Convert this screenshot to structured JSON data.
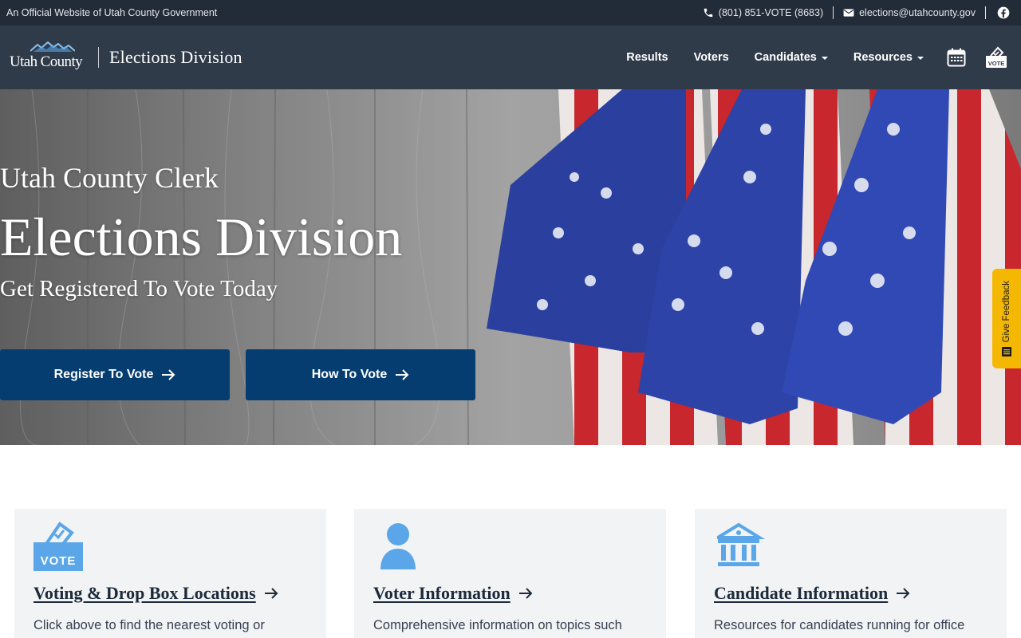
{
  "utility": {
    "official_text": "An Official Website of Utah County Government",
    "phone": "(801) 851-VOTE (8683)",
    "email": "elections@utahcounty.gov"
  },
  "header": {
    "logo_text": "Utah County",
    "division_title": "Elections Division",
    "nav": {
      "results": "Results",
      "voters": "Voters",
      "candidates": "Candidates",
      "resources": "Resources"
    },
    "vote_icon_label": "VOTE"
  },
  "hero": {
    "kicker": "Utah County Clerk",
    "title": "Elections Division",
    "subtitle": "Get Registered To Vote Today",
    "register_button": "Register To Vote",
    "how_button": "How To Vote"
  },
  "feedback": {
    "label": "Give Feedback"
  },
  "cards": [
    {
      "title": "Voting & Drop Box Locations",
      "description": "Click above to find the nearest voting or",
      "icon": "ballot-box-icon",
      "icon_label": "VOTE"
    },
    {
      "title": "Voter Information",
      "description": "Comprehensive information on topics such",
      "icon": "user-icon"
    },
    {
      "title": "Candidate Information",
      "description": "Resources for candidates running for office",
      "icon": "government-building-icon"
    }
  ],
  "colors": {
    "utility_bg": "#222b38",
    "header_bg": "#303b4a",
    "button_bg": "#053d70",
    "icon_blue": "#5aa6e8",
    "feedback_bg": "#f5b800",
    "card_bg": "#f1f3f5"
  }
}
